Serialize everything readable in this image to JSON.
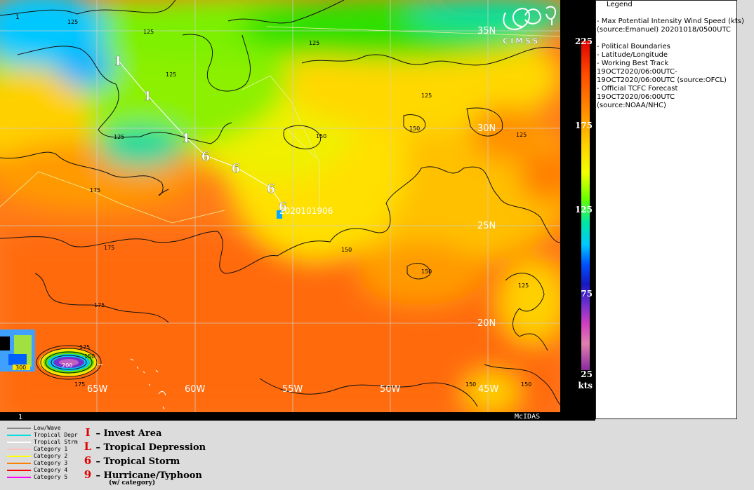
{
  "map": {
    "latitude_labels": [
      "35N",
      "30N",
      "25N",
      "20N"
    ],
    "longitude_labels": [
      "65W",
      "60W",
      "55W",
      "50W",
      "45W"
    ],
    "contour_labels": [
      "125",
      "125",
      "125",
      "125",
      "125",
      "125",
      "125",
      "125",
      "150",
      "150",
      "150",
      "150",
      "150",
      "150",
      "150",
      "175",
      "175",
      "175",
      "175",
      "175",
      "200",
      "300"
    ],
    "track_symbols": [
      "1",
      "1",
      "1",
      "6",
      "6",
      "6",
      "6"
    ],
    "storm_label": "2020101906",
    "corner_label": "1",
    "logo_text": "CIMSS",
    "mcidas_label": "McIDAS"
  },
  "colorbar": {
    "ticks": [
      "225",
      "175",
      "125",
      "75",
      "25"
    ],
    "units": "kts",
    "colors": [
      "#e00000",
      "#ff5a00",
      "#ff9a00",
      "#ffd200",
      "#f4ff00",
      "#9cff00",
      "#2ee800",
      "#00e0a0",
      "#00c8ff",
      "#0060ff",
      "#1010c8",
      "#7030d0",
      "#c020c0",
      "#e070b0",
      "#c060c0",
      "#9030a0"
    ]
  },
  "legend": {
    "lines": [
      "Legend",
      "",
      "-  Max Potential Intensity  Wind Speed (kts)",
      "(source:Emanuel)   20201018/0500UTC",
      "",
      "-  Political Boundaries",
      "-  Latitude/Longitude",
      "-  Working Best Track",
      "19OCT2020/06:00UTC-",
      "19OCT2020/06:00UTC   (source:OFCL)",
      "-  Official TCFC Forecast",
      "19OCT2020/06:00UTC",
      "(source:NOAA/NHC)"
    ]
  },
  "line_legend": [
    {
      "label": "Low/Wave",
      "color": "#888888"
    },
    {
      "label": "Tropical Depr",
      "color": "#00e0e0"
    },
    {
      "label": "Tropical Strm",
      "color": "#ffffff"
    },
    {
      "label": "Category 1",
      "color": "#ffc0c0"
    },
    {
      "label": "Category 2",
      "color": "#ffff00"
    },
    {
      "label": "Category 3",
      "color": "#ff8000"
    },
    {
      "label": "Category 4",
      "color": "#ff0000"
    },
    {
      "label": "Category 5",
      "color": "#ff00ff"
    }
  ],
  "symbol_legend": [
    {
      "symbol": "I",
      "label": "– Invest Area"
    },
    {
      "symbol": "L",
      "label": "– Tropical Depression"
    },
    {
      "symbol": "6",
      "label": "– Tropical Storm"
    },
    {
      "symbol": "9",
      "label": "– Hurricane/Typhoon"
    }
  ],
  "symbol_legend_note": "(w/ category)"
}
